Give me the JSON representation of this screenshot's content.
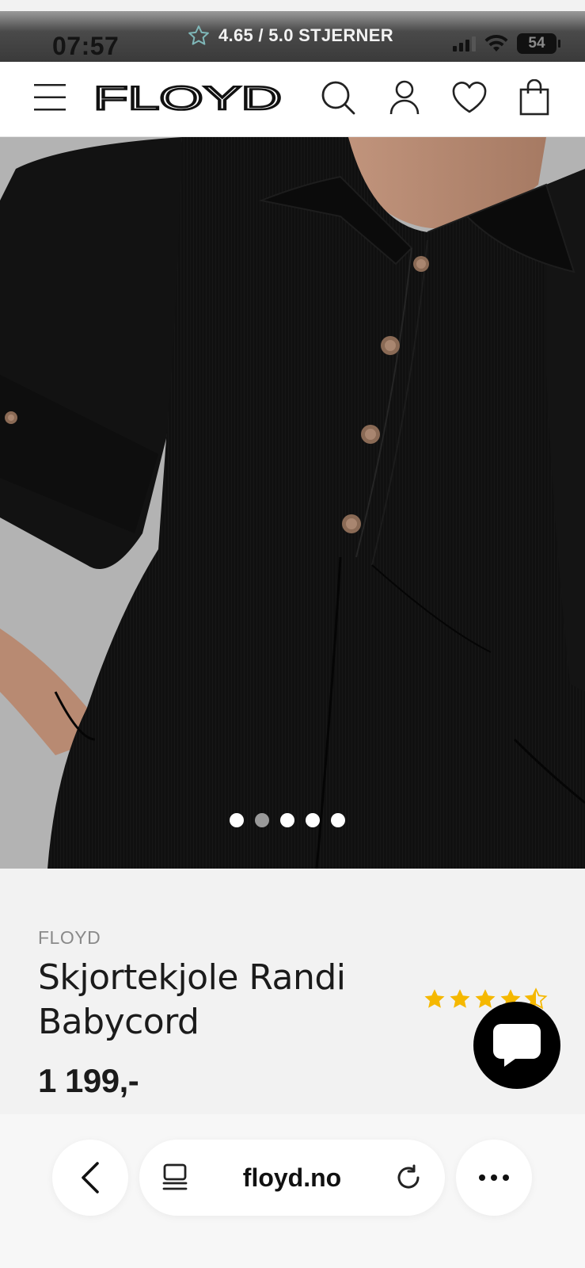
{
  "status_bar": {
    "time": "07:57",
    "promo": "4.65 / 5.0 STJERNER",
    "battery": "54"
  },
  "header": {
    "brand_logo": "FLOYD",
    "icons": [
      "menu-icon",
      "search-icon",
      "account-icon",
      "wishlist-icon",
      "cart-icon"
    ]
  },
  "gallery": {
    "image_alt": "Black corduroy shirt dress with wooden buttons",
    "dots": 5,
    "active_dot": 2
  },
  "product": {
    "brand": "FLOYD",
    "title": "Skjortekjole Randi Babycord",
    "price": "1 199,-",
    "rating_stars": 4.5
  },
  "browser": {
    "url": "floyd.no"
  },
  "colors": {
    "accent_star": "#f5b800",
    "text": "#1b1b1b",
    "background": "#f2f2f2"
  }
}
